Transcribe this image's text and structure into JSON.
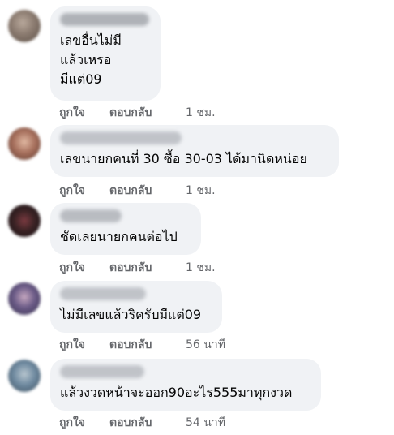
{
  "comments": [
    {
      "text_lines": [
        "เลขอื่นไม่มี",
        "แล้วเหรอ",
        "มีแต่09"
      ],
      "actions": {
        "like": "ถูกใจ",
        "reply": "ตอบกลับ",
        "time": "1 ชม."
      },
      "avatar_color": "#8a7a6f"
    },
    {
      "text_lines": [
        "เลขนายกคนที่ 30 ซื้อ 30-03 ได้มานิดหน่อย"
      ],
      "actions": {
        "like": "ถูกใจ",
        "reply": "ตอบกลับ",
        "time": "1 ชม."
      },
      "avatar_color": "#a7705d"
    },
    {
      "text_lines": [
        "ชัดเลยนายกคนต่อไป"
      ],
      "actions": {
        "like": "ถูกใจ",
        "reply": "ตอบกลับ",
        "time": "1 ชม."
      },
      "avatar_color": "#3a2224"
    },
    {
      "text_lines": [
        "ไม่มีเลขแล้วริครับมีแต่09"
      ],
      "actions": {
        "like": "ถูกใจ",
        "reply": "ตอบกลับ",
        "time": "56 นาที"
      },
      "avatar_color": "#6a5a86"
    },
    {
      "text_lines": [
        "แล้วงวดหน้าจะออก90อะไร555มาทุกงวด"
      ],
      "actions": {
        "like": "ถูกใจ",
        "reply": "ตอบกลับ",
        "time": "54 นาที"
      },
      "avatar_color": "#6f8aa0"
    }
  ],
  "colors": {
    "bubble_bg": "#f0f2f5",
    "meta_text": "#65676b",
    "body_text": "#050505"
  }
}
